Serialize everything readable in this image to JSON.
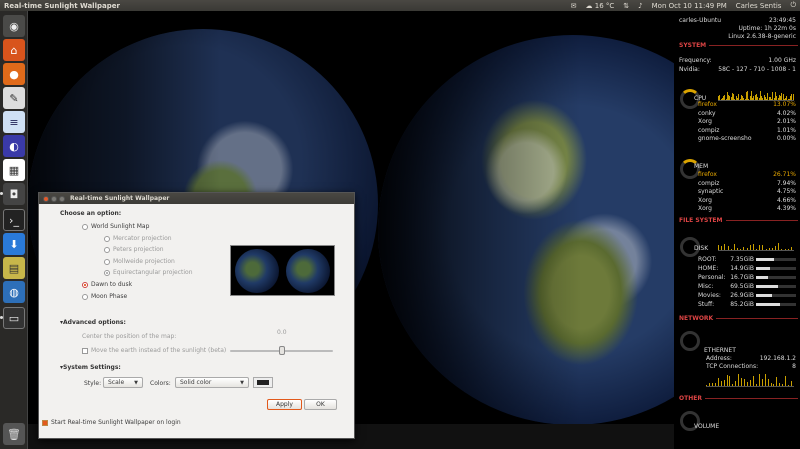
{
  "top_panel": {
    "title": "Real-time Sunlight Wallpaper",
    "temperature": "16 °C",
    "datetime": "Mon Oct 10 11:49 PM",
    "user": "Carles Sentis"
  },
  "dialog": {
    "title": "Real-time Sunlight Wallpaper",
    "choose_label": "Choose an option:",
    "options": {
      "world_map": "World Sunlight Map",
      "mercator": "Mercator projection",
      "peters": "Peters projection",
      "mollweide": "Mollweide projection",
      "equirect": "Equirectangular projection",
      "dawn_dusk": "Dawn to dusk",
      "moon_phase": "Moon Phase"
    },
    "advanced_label": "Advanced options:",
    "center_label": "Center the position of the map:",
    "slider_value": "0.0",
    "move_earth_label": "Move the earth instead of the sunlight (beta)",
    "system_label": "System Settings:",
    "style_label": "Style:",
    "style_value": "Scale",
    "colors_label": "Colors:",
    "colors_value": "Solid color",
    "apply_label": "Apply",
    "ok_label": "OK",
    "startup_label": "Start Real-time Sunlight Wallpaper on login"
  },
  "conky": {
    "host": "carles-Ubuntu",
    "time": "23:49:45",
    "uptime": "Uptime: 1h 22m 0s",
    "kernel": "Linux 2.6.38-8-generic",
    "system_header": "SYSTEM",
    "frequency_label": "Frequency:",
    "frequency_value": "1.00 GHz",
    "nvidia_label": "Nvidia:",
    "nvidia_value": "58C - 127 - 710 - 1008 - 1",
    "cpu_label": "CPU",
    "cpu_procs": [
      {
        "name": "firefox",
        "val": "13.07%"
      },
      {
        "name": "conky",
        "val": "4.02%"
      },
      {
        "name": "Xorg",
        "val": "2.01%"
      },
      {
        "name": "compiz",
        "val": "1.01%"
      },
      {
        "name": "gnome-screensho",
        "val": "0.00%"
      }
    ],
    "mem_label": "MEM",
    "mem_procs": [
      {
        "name": "firefox",
        "val": "26.71%"
      },
      {
        "name": "compiz",
        "val": "7.94%"
      },
      {
        "name": "synaptic",
        "val": "4.75%"
      },
      {
        "name": "Xorg",
        "val": "4.66%"
      },
      {
        "name": "Xorg",
        "val": "4.39%"
      }
    ],
    "fs_header": "FILE SYSTEM",
    "disk_label": "DISK",
    "disks": [
      {
        "name": "ROOT:",
        "val": "7.35GiB",
        "fill": 0.45
      },
      {
        "name": "HOME:",
        "val": "14.9GiB",
        "fill": 0.35
      },
      {
        "name": "Personal:",
        "val": "16.7GiB",
        "fill": 0.3
      },
      {
        "name": "Misc:",
        "val": "69.5GiB",
        "fill": 0.55
      },
      {
        "name": "Movies:",
        "val": "26.9GiB",
        "fill": 0.4
      },
      {
        "name": "Stuff:",
        "val": "85.2GiB",
        "fill": 0.6
      }
    ],
    "network_header": "NETWORK",
    "ethernet_label": "ETHERNET",
    "address_label": "Address:",
    "address_value": "192.168.1.2",
    "tcp_label": "TCP Connections:",
    "tcp_value": "8",
    "other_header": "OTHER",
    "volume_label": "VOLUME"
  }
}
